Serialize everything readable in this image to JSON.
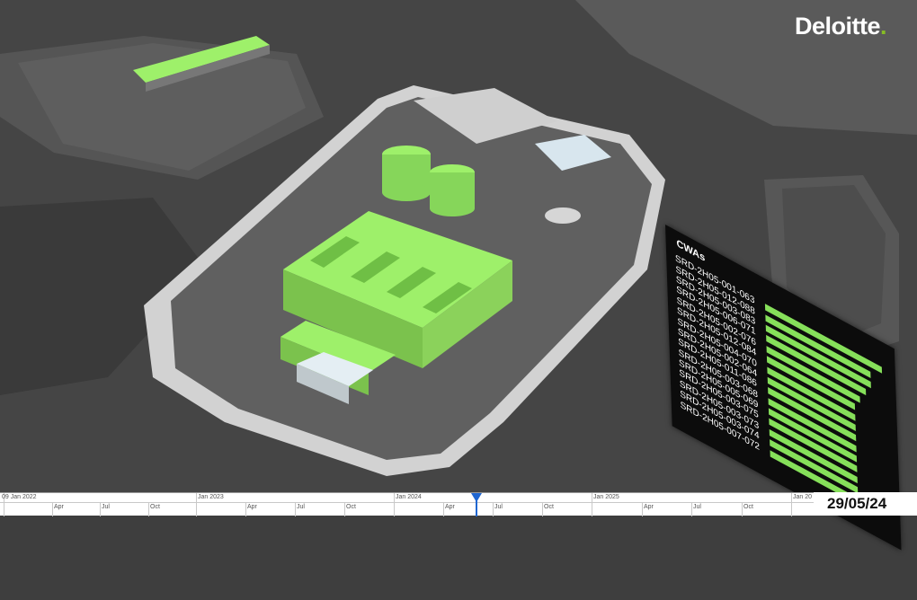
{
  "brand": {
    "name": "Deloitte",
    "dot": "."
  },
  "panel": {
    "title": "CWAs",
    "items": [
      {
        "label": "SRD-2H05-001-063",
        "progress": 1.0
      },
      {
        "label": "SRD-2H05-012-088",
        "progress": 0.9
      },
      {
        "label": "SRD-2H05-003-083",
        "progress": 0.9
      },
      {
        "label": "SRD-2H05-006-071",
        "progress": 0.85
      },
      {
        "label": "SRD-2H05-002-076",
        "progress": 0.8
      },
      {
        "label": "SRD-2H05-012-084",
        "progress": 0.75
      },
      {
        "label": "SRD-2H05-004-070",
        "progress": 0.75
      },
      {
        "label": "SRD-2H05-002-064",
        "progress": 0.75
      },
      {
        "label": "SRD-2H05-011-086",
        "progress": 0.75
      },
      {
        "label": "SRD-2H05-003-068",
        "progress": 0.75
      },
      {
        "label": "SRD-2H05-005-069",
        "progress": 0.75
      },
      {
        "label": "SRD-2H05-003-075",
        "progress": 0.75
      },
      {
        "label": "SRD-2H05-003-073",
        "progress": 0.75
      },
      {
        "label": "SRD-2H05-003-074",
        "progress": 0.75
      },
      {
        "label": "SRD-2H05-007-072",
        "progress": 0.75
      }
    ]
  },
  "timeline": {
    "years": [
      "09 Jan 2022",
      "Jan 2023",
      "Jan 2024",
      "Jan 2025",
      "Jan 20"
    ],
    "months": [
      "Apr",
      "Jul",
      "Oct",
      "Apr",
      "Jul",
      "Oct",
      "Apr",
      "Jul",
      "Oct",
      "Apr",
      "Jul",
      "Oct"
    ],
    "current_date": "29/05/24"
  },
  "colors": {
    "accent_green": "#86e05a",
    "marker_blue": "#1f66d1",
    "brand_green": "#86bc25"
  }
}
